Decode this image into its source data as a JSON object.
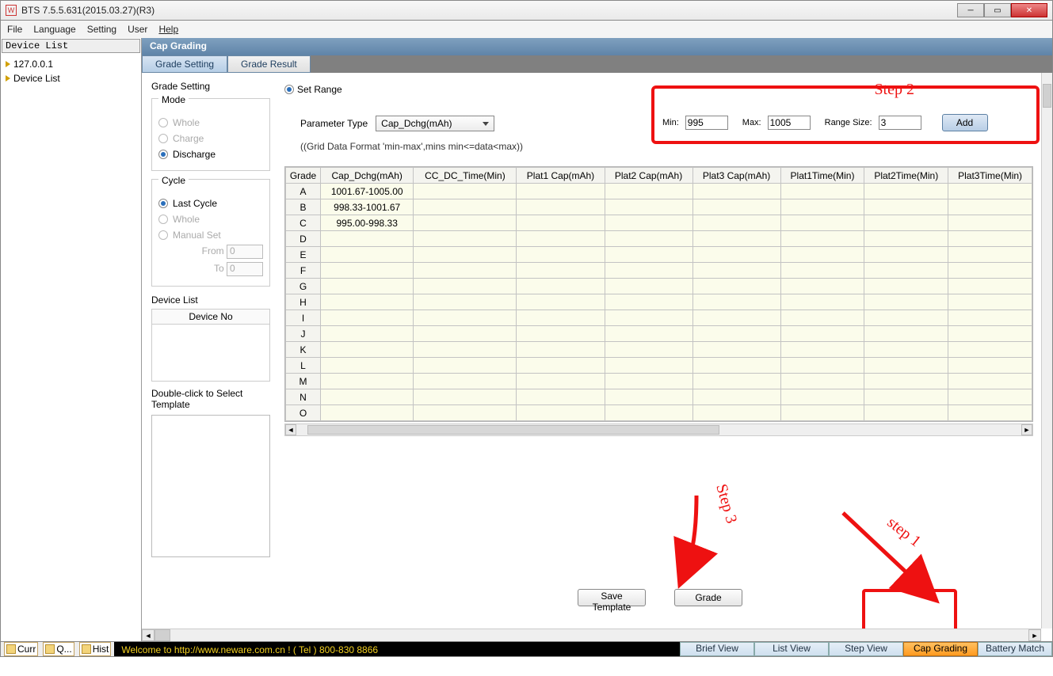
{
  "window": {
    "title": "BTS 7.5.5.631(2015.03.27)(R3)"
  },
  "menu": [
    "File",
    "Language",
    "Setting",
    "User",
    "Help"
  ],
  "device_list": {
    "title": "Device List",
    "items": [
      "127.0.0.1",
      "Device List"
    ]
  },
  "ribbon": {
    "title": "Cap Grading"
  },
  "tabs": {
    "a": "Grade Setting",
    "b": "Grade Result"
  },
  "grade_setting": {
    "title": "Grade Setting",
    "mode": {
      "legend": "Mode",
      "whole": "Whole",
      "charge": "Charge",
      "discharge": "Discharge"
    },
    "cycle": {
      "legend": "Cycle",
      "last": "Last Cycle",
      "whole": "Whole",
      "manual": "Manual Set",
      "from": "From",
      "to": "To",
      "from_v": "0",
      "to_v": "0"
    },
    "devlist": {
      "legend": "Device List",
      "col": "Device No"
    },
    "tmpl": "Double-click to Select Template"
  },
  "setrange": {
    "label": "Set Range",
    "param": "Parameter Type",
    "param_val": "Cap_Dchg(mAh)",
    "hint": "((Grid Data Format 'min-max',mins min<=data<max))"
  },
  "step2": {
    "label": "Step 2",
    "min": "Min:",
    "min_v": "995",
    "max": "Max:",
    "max_v": "1005",
    "rs": "Range Size:",
    "rs_v": "3",
    "add": "Add"
  },
  "table": {
    "headers": [
      "Grade",
      "Cap_Dchg(mAh)",
      "CC_DC_Time(Min)",
      "Plat1 Cap(mAh)",
      "Plat2 Cap(mAh)",
      "Plat3 Cap(mAh)",
      "Plat1Time(Min)",
      "Plat2Time(Min)",
      "Plat3Time(Min)"
    ],
    "rows": [
      {
        "g": "A",
        "v": "1001.67-1005.00"
      },
      {
        "g": "B",
        "v": "998.33-1001.67"
      },
      {
        "g": "C",
        "v": "995.00-998.33"
      },
      {
        "g": "D",
        "v": ""
      },
      {
        "g": "E",
        "v": ""
      },
      {
        "g": "F",
        "v": ""
      },
      {
        "g": "G",
        "v": ""
      },
      {
        "g": "H",
        "v": ""
      },
      {
        "g": "I",
        "v": ""
      },
      {
        "g": "J",
        "v": ""
      },
      {
        "g": "K",
        "v": ""
      },
      {
        "g": "L",
        "v": ""
      },
      {
        "g": "M",
        "v": ""
      },
      {
        "g": "N",
        "v": ""
      },
      {
        "g": "O",
        "v": ""
      }
    ]
  },
  "buttons": {
    "save": "Save Template",
    "grade": "Grade"
  },
  "steps": {
    "s1": "step 1",
    "s3": "Step 3"
  },
  "status": {
    "tabs": [
      "Curr",
      "Q...",
      "Hist"
    ],
    "welcome": "Welcome to http://www.neware.com.cn !    ( Tel ) 800-830 8866",
    "views": [
      "Brief View",
      "List View",
      "Step View",
      "Cap Grading",
      "Battery Match"
    ]
  }
}
